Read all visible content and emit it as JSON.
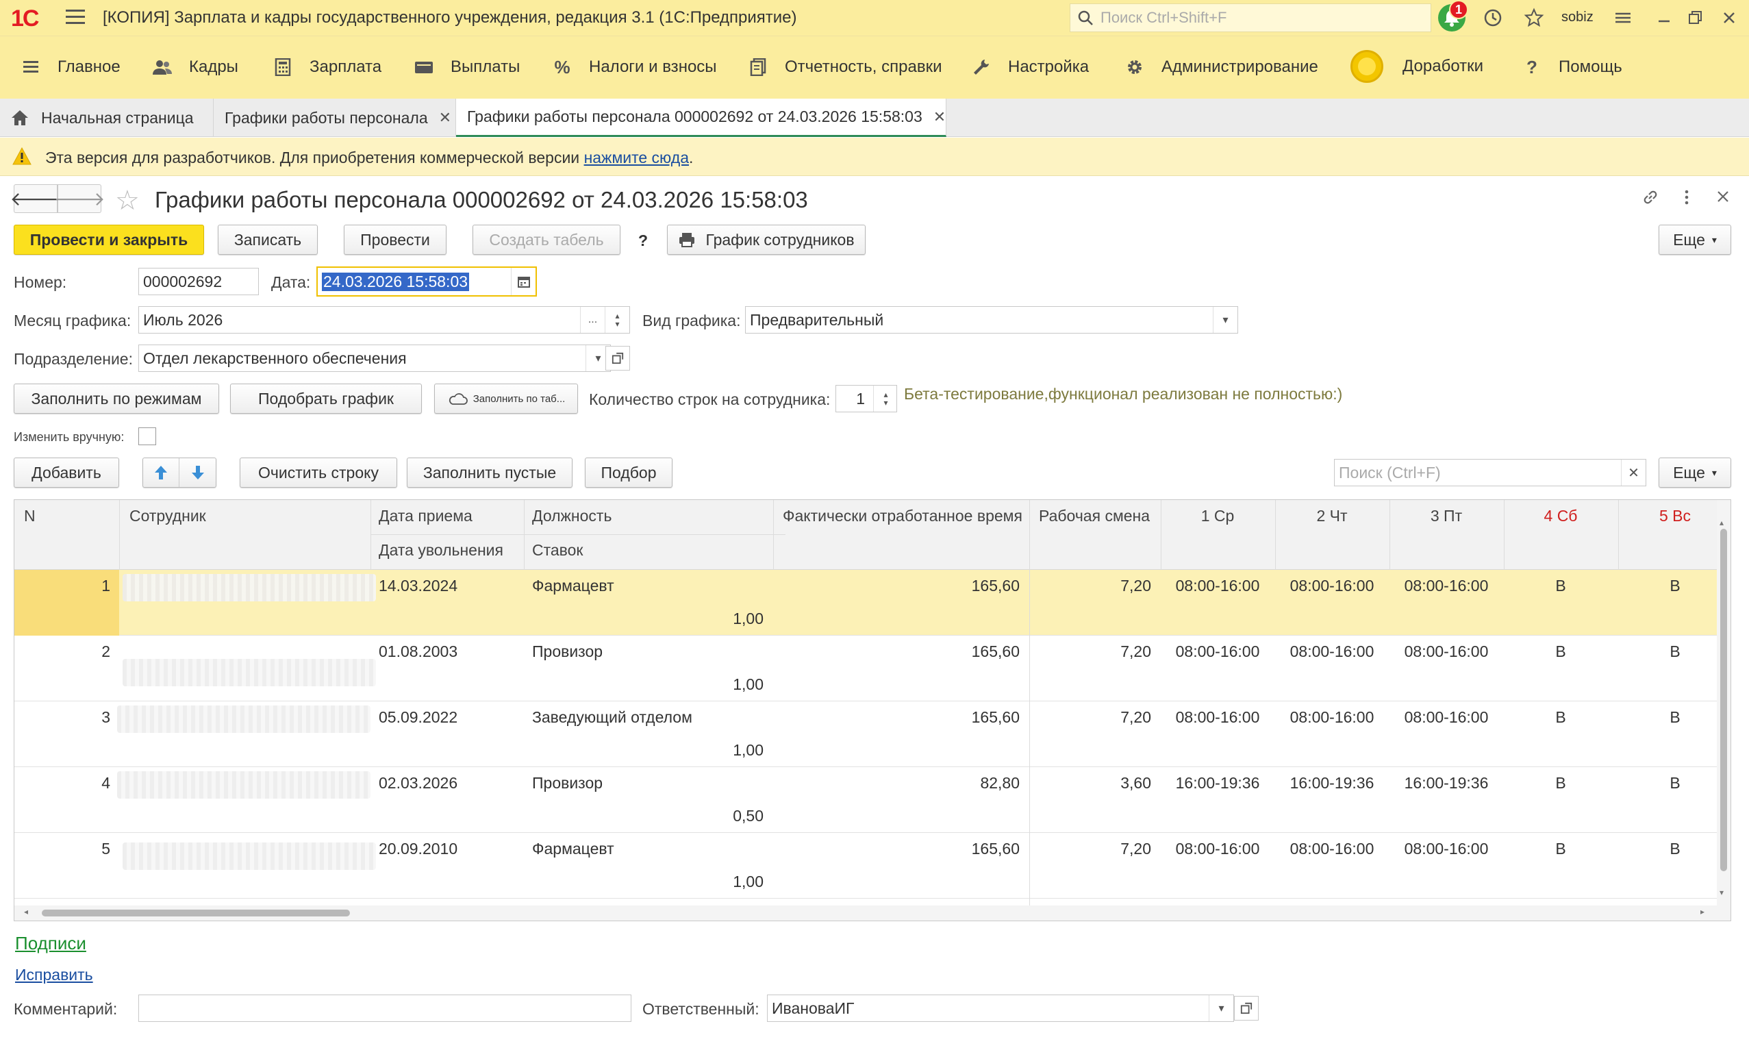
{
  "app": {
    "logo": "1С",
    "title": "[КОПИЯ] Зарплата и кадры государственного учреждения, редакция 3.1  (1С:Предприятие)",
    "search_placeholder": "Поиск Ctrl+Shift+F",
    "notification_count": "1",
    "user": "sobiz"
  },
  "menu": [
    {
      "label": "Главное",
      "icon": "hamburger-icon"
    },
    {
      "label": "Кадры",
      "icon": "people-icon"
    },
    {
      "label": "Зарплата",
      "icon": "calculator-icon"
    },
    {
      "label": "Выплаты",
      "icon": "wallet-icon"
    },
    {
      "label": "Налоги и взносы",
      "icon": "percent-icon"
    },
    {
      "label": "Отчетность, справки",
      "icon": "report-icon"
    },
    {
      "label": "Настройка",
      "icon": "wrench-icon"
    },
    {
      "label": "Администрирование",
      "icon": "gear-icon"
    },
    {
      "label": "Доработки",
      "icon": "coin-icon"
    },
    {
      "label": "Помощь",
      "icon": "help-icon"
    }
  ],
  "tabs": [
    {
      "label": "Начальная страница"
    },
    {
      "label": "Графики работы персонала"
    },
    {
      "label": "Графики работы персонала 000002692 от 24.03.2026 15:58:03"
    }
  ],
  "banner": {
    "text": "Эта версия для разработчиков. Для приобретения коммерческой версии ",
    "link": "нажмите сюда",
    "suffix": "."
  },
  "form": {
    "title": "Графики работы персонала 000002692 от 24.03.2026 15:58:03",
    "buttons": {
      "post_close": "Провести и закрыть",
      "save": "Записать",
      "post": "Провести",
      "create_timesheet": "Создать табель",
      "help": "?",
      "employee_schedule": "График сотрудников",
      "more": "Еще"
    },
    "number_label": "Номер:",
    "number_value": "000002692",
    "date_label": "Дата:",
    "date_value": "24.03.2026 15:58:03",
    "month_label": "Месяц графика:",
    "month_value": "Июль 2026",
    "type_label": "Вид графика:",
    "type_value": "Предварительный",
    "dept_label": "Подразделение:",
    "dept_value": "Отдел лекарственного обеспечения",
    "fill_by_modes": "Заполнить по режимам",
    "pick_schedule": "Подобрать график",
    "fill_by_tab": "Заполнить по таб...",
    "rows_per_employee_label": "Количество строк на сотрудника:",
    "rows_per_employee_value": "1",
    "beta_note": "Бета-тестирование,функционал реализован не полностью:)",
    "manual_edit_label": "Изменить вручную:",
    "table_buttons": {
      "add": "Добавить",
      "clear_row": "Очистить строку",
      "fill_empty": "Заполнить пустые",
      "selection": "Подбор",
      "search_placeholder": "Поиск (Ctrl+F)",
      "more": "Еще"
    }
  },
  "table": {
    "headers": {
      "n": "N",
      "employee": "Сотрудник",
      "hire_date": "Дата приема",
      "fire_date": "Дата увольнения",
      "position": "Должность",
      "rate": "Ставок",
      "actual_time": "Фактически отработанное время",
      "shift": "Рабочая смена",
      "d1": "1 Ср",
      "d2": "2 Чт",
      "d3": "3 Пт",
      "d4": "4 Сб",
      "d5": "5 Вс"
    },
    "weekend_color": "#d0201f",
    "rows": [
      {
        "n": "1",
        "hire": "14.03.2024",
        "position": "Фармацевт",
        "rate": "1,00",
        "actual": "165,60",
        "shift": "7,20",
        "d1": "08:00-16:00",
        "d2": "08:00-16:00",
        "d3": "08:00-16:00",
        "d4": "В",
        "d5": "В"
      },
      {
        "n": "2",
        "hire": "01.08.2003",
        "position": "Провизор",
        "rate": "1,00",
        "actual": "165,60",
        "shift": "7,20",
        "d1": "08:00-16:00",
        "d2": "08:00-16:00",
        "d3": "08:00-16:00",
        "d4": "В",
        "d5": "В"
      },
      {
        "n": "3",
        "hire": "05.09.2022",
        "position": "Заведующий отделом",
        "rate": "1,00",
        "actual": "165,60",
        "shift": "7,20",
        "d1": "08:00-16:00",
        "d2": "08:00-16:00",
        "d3": "08:00-16:00",
        "d4": "В",
        "d5": "В"
      },
      {
        "n": "4",
        "hire": "02.03.2026",
        "position": "Провизор",
        "rate": "0,50",
        "actual": "82,80",
        "shift": "3,60",
        "d1": "16:00-19:36",
        "d2": "16:00-19:36",
        "d3": "16:00-19:36",
        "d4": "В",
        "d5": "В"
      },
      {
        "n": "5",
        "hire": "20.09.2010",
        "position": "Фармацевт",
        "rate": "1,00",
        "actual": "165,60",
        "shift": "7,20",
        "d1": "08:00-16:00",
        "d2": "08:00-16:00",
        "d3": "08:00-16:00",
        "d4": "В",
        "d5": "В"
      }
    ]
  },
  "footer": {
    "signatures": "Подписи",
    "fix": "Исправить",
    "comment_label": "Комментарий:",
    "comment_value": "",
    "responsible_label": "Ответственный:",
    "responsible_value": "ИвановаИГ"
  }
}
